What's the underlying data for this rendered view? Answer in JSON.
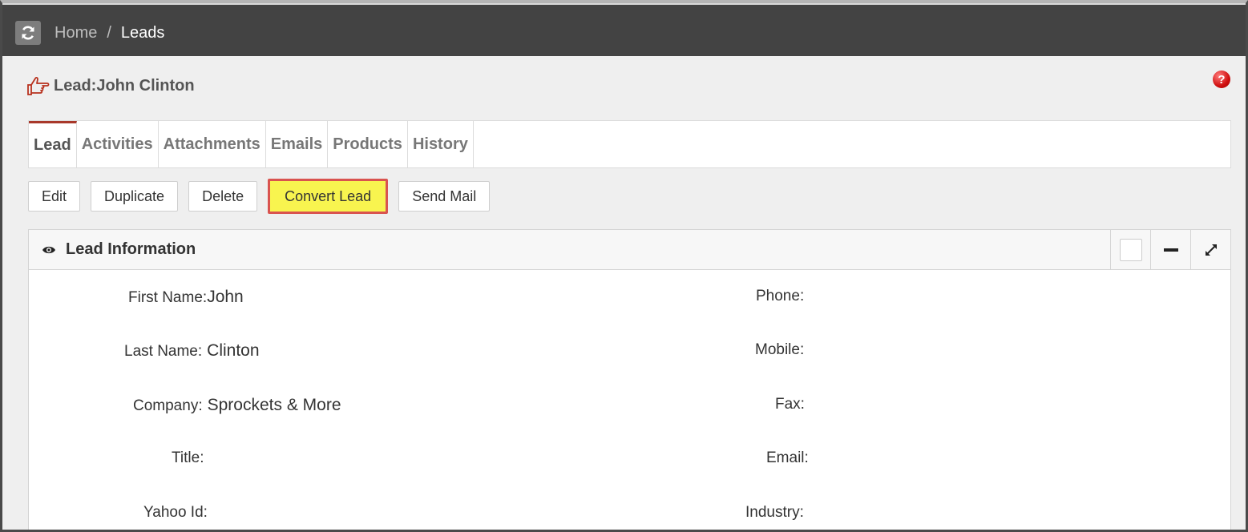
{
  "breadcrumb": {
    "home": "Home",
    "separator": "/",
    "current": "Leads"
  },
  "page": {
    "title": "Lead:John Clinton"
  },
  "tabs": [
    {
      "label": "Lead",
      "active": true
    },
    {
      "label": "Activities"
    },
    {
      "label": "Attachments"
    },
    {
      "label": "Emails"
    },
    {
      "label": "Products"
    },
    {
      "label": "History"
    }
  ],
  "actions": {
    "edit": "Edit",
    "duplicate": "Duplicate",
    "delete": "Delete",
    "convert": "Convert Lead",
    "send_mail": "Send Mail"
  },
  "panel": {
    "title": "Lead Information",
    "left_fields": [
      {
        "label": "First Name:",
        "value": "John"
      },
      {
        "label": "Last Name:",
        "value": "Clinton"
      },
      {
        "label": "Company:",
        "value": "Sprockets & More"
      },
      {
        "label": "Title:",
        "value": ""
      },
      {
        "label": "Yahoo Id:",
        "value": ""
      }
    ],
    "right_fields": [
      {
        "label": "Phone:",
        "value": ""
      },
      {
        "label": "Mobile:",
        "value": ""
      },
      {
        "label": "Fax:",
        "value": ""
      },
      {
        "label": "Email:",
        "value": ""
      },
      {
        "label": "Industry:",
        "value": ""
      }
    ]
  },
  "colors": {
    "topbar": "#434343",
    "accent": "#a8382a",
    "highlight_fill": "#f8f44f",
    "highlight_border": "#d9534f"
  }
}
